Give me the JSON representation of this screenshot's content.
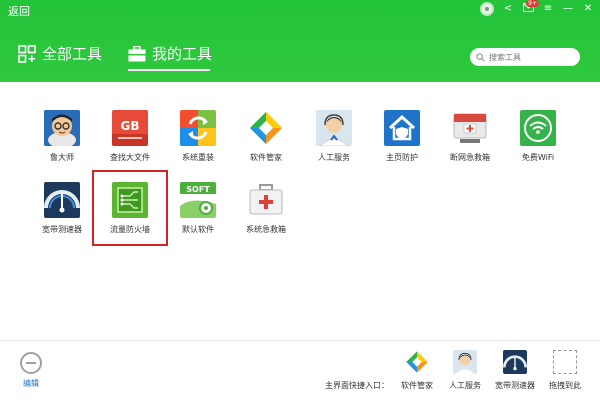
{
  "header": {
    "back_label": "返回",
    "tabs": [
      {
        "label": "全部工具",
        "icon": "grid-icon"
      },
      {
        "label": "我的工具",
        "icon": "toolbox-icon"
      }
    ],
    "search_placeholder": "搜索工具",
    "notification_count": "9+"
  },
  "tools": [
    {
      "label": "鲁大师",
      "icon": "master-lu-icon"
    },
    {
      "label": "查找大文件",
      "icon": "gb-file-icon"
    },
    {
      "label": "系统重装",
      "icon": "system-reinstall-icon"
    },
    {
      "label": "软件管家",
      "icon": "software-manager-icon"
    },
    {
      "label": "人工服务",
      "icon": "human-service-icon"
    },
    {
      "label": "主页防护",
      "icon": "homepage-protect-icon"
    },
    {
      "label": "断网急救箱",
      "icon": "network-first-aid-icon"
    },
    {
      "label": "免费WiFi",
      "icon": "wifi-icon"
    },
    {
      "label": "宽带测速器",
      "icon": "speed-test-icon"
    },
    {
      "label": "流量防火墙",
      "icon": "traffic-firewall-icon"
    },
    {
      "label": "默认软件",
      "icon": "default-software-icon"
    },
    {
      "label": "系统急救箱",
      "icon": "system-first-aid-icon"
    }
  ],
  "footer": {
    "edit_label": "编辑",
    "quick_entry_label": "主界面快捷入口：",
    "quick_items": [
      {
        "label": "软件管家",
        "icon": "software-manager-icon"
      },
      {
        "label": "人工服务",
        "icon": "human-service-icon"
      },
      {
        "label": "宽带测速器",
        "icon": "speed-test-icon"
      },
      {
        "label": "拖拽到此",
        "icon": "drop-target-icon"
      }
    ]
  },
  "colors": {
    "header_green": "#2fc83e",
    "highlight_red": "#d32222",
    "edit_link_blue": "#1a73c9"
  }
}
